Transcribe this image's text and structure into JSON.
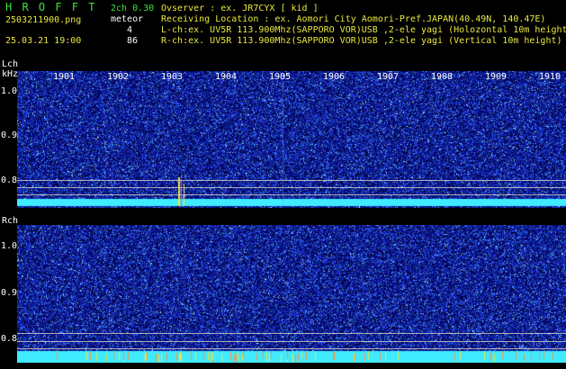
{
  "header": {
    "app_title": "H R O F F T",
    "channel_version": "2ch 0.30",
    "filename": "2503211900.png",
    "meteor_label": "meteor",
    "datetime": "25.03.21 19:00",
    "lch_count": "4",
    "rch_count": "86",
    "observer_line": "Ovserver                : ex. JR7CYX [ kid ]",
    "location_line": "Receiving Location : ex. Aomori City Aomori-Pref.JAPAN(40.49N, 140.47E)",
    "lch_line": "L-ch:ex. UV5R 113.900Mhz(SAPPORO VOR)USB ,2-ele yagi (Holozontal 10m height",
    "rch_line": "R-ch:ex. UV5R 113.900Mhz(SAPPORO VOR)USB ,2-ele yagi (Vertical 10m height)"
  },
  "lch_panel": {
    "channel_label": "Lch",
    "unit_label": "kHz",
    "time_ticks": [
      "1901",
      "1902",
      "1903",
      "1904",
      "1905",
      "1906",
      "1907",
      "1908",
      "1909",
      "1910"
    ],
    "freq_ticks": [
      "1.0",
      "0.9",
      "0.8"
    ]
  },
  "rch_panel": {
    "channel_label": "Rch",
    "freq_ticks": [
      "1.0",
      "0.9",
      "0.8"
    ]
  },
  "colors": {
    "background": "#000000",
    "noise_dark": "#0a1470",
    "noise_blue": "#2a44e0",
    "band_cyan": "#40f0ff",
    "text_green": "#3ee03e",
    "text_yellow": "#e8e840"
  }
}
